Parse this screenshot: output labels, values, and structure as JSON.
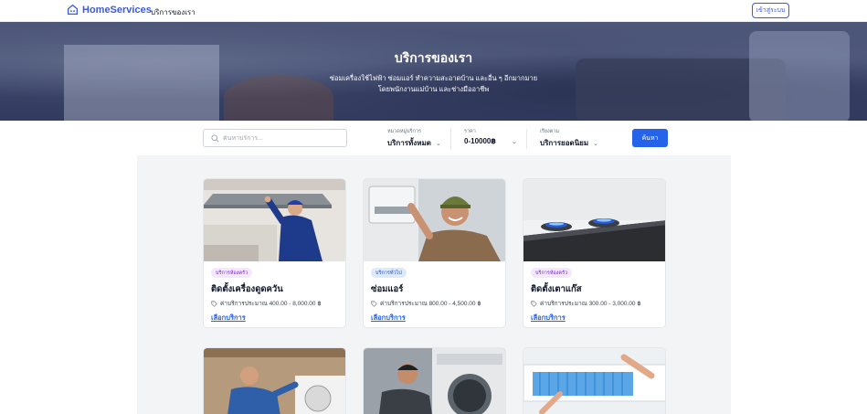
{
  "header": {
    "brand": "HomeServices",
    "nav_link": "บริการของเรา",
    "login": "เข้าสู่ระบบ"
  },
  "hero": {
    "title": "บริการของเรา",
    "subtitle_line1": "ซ่อมเครื่องใช้ไฟฟ้า ซ่อมแอร์ ทำความสะอาดบ้าน และอื่น ๆ อีกมากมาย",
    "subtitle_line2": "โดยพนักงานแม่บ้าน และช่างมืออาชีพ"
  },
  "filters": {
    "search_placeholder": "ค้นหาบริการ...",
    "category_label": "หมวดหมู่บริการ",
    "category_value": "บริการทั้งหมด",
    "price_label": "ราคา",
    "price_value": "0-10000฿",
    "sort_label": "เรียงตาม",
    "sort_value": "บริการยอดนิยม",
    "search_button": "ค้นหา"
  },
  "cards": [
    {
      "badge": "บริการห้องครัว",
      "badge_color": "#f3e8ff",
      "badge_text_color": "#7e22ce",
      "title": "ติดตั้งเครื่องดูดควัน",
      "price": "ค่าบริการประมาณ 400.00 - 8,000.00 ฿",
      "link": "เลือกบริการ"
    },
    {
      "badge": "บริการทั่วไป",
      "badge_color": "#dbeafe",
      "badge_text_color": "#1d4ed8",
      "title": "ซ่อมแอร์",
      "price": "ค่าบริการประมาณ 800.00 - 4,500.00 ฿",
      "link": "เลือกบริการ"
    },
    {
      "badge": "บริการห้องครัว",
      "badge_color": "#f3e8ff",
      "badge_text_color": "#7e22ce",
      "title": "ติดตั้งเตาแก๊ส",
      "price": "ค่าบริการประมาณ 300.00 - 3,000.00 ฿",
      "link": "เลือกบริการ"
    }
  ],
  "colors": {
    "primary": "#2563eb",
    "brand": "#3b5bdb"
  }
}
